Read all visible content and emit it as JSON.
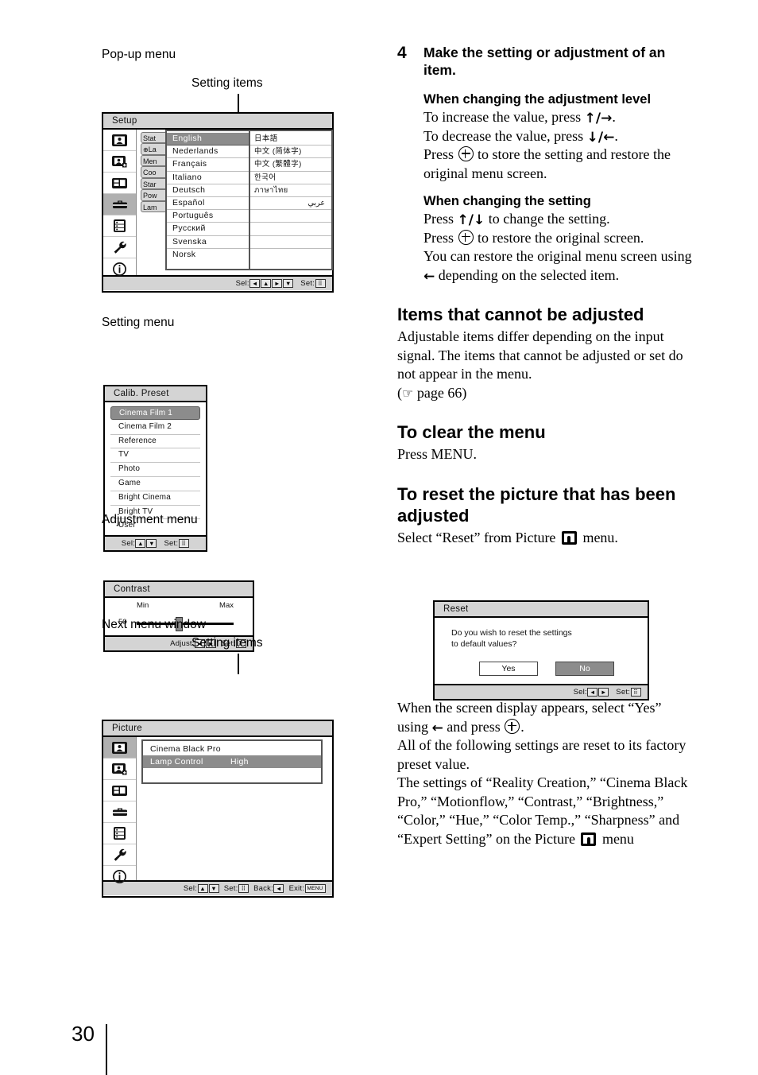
{
  "page": {
    "number": "30"
  },
  "left": {
    "captions": {
      "popup_menu": "Pop-up menu",
      "setting_items_1": "Setting items",
      "setting_menu": "Setting menu",
      "adjustment_menu": "Adjustment menu",
      "next_menu_window": "Next menu window",
      "setting_items_2": "Setting items"
    },
    "setup_window": {
      "title": "Setup",
      "side_icons": [
        "picture-icon",
        "picture-plus-icon",
        "screen-icon",
        "toolbox-icon",
        "list-icon",
        "wrench-icon",
        "info-icon"
      ],
      "selected_side_icon_index": 3,
      "hidden_labels": [
        "Stat",
        "La",
        "Men",
        "Coo",
        "Star",
        "Pow",
        "Lam"
      ],
      "languages_col1": [
        "English",
        "Nederlands",
        "Français",
        "Italiano",
        "Deutsch",
        "Español",
        "Português",
        "Русский",
        "Svenska",
        "Norsk"
      ],
      "selected_language": "English",
      "languages_col2": [
        "日本語",
        "中文 (简体字)",
        "中文 (繁體字)",
        "한국어",
        "ภาษาไทย",
        "عربي",
        "",
        "",
        "",
        ""
      ],
      "footer": {
        "sel_label": "Sel:",
        "set_label": "Set:",
        "sel_keys": [
          "◄",
          "▲",
          "►",
          "▼"
        ],
        "set_key": "⠿"
      }
    },
    "calib_window": {
      "title": "Calib. Preset",
      "items": [
        "Cinema Film 1",
        "Cinema Film 2",
        "Reference",
        "TV",
        "Photo",
        "Game",
        "Bright Cinema",
        "Bright TV",
        "User"
      ],
      "selected_item": "Cinema Film 1",
      "footer": {
        "sel_label": "Sel:",
        "set_label": "Set:",
        "sel_keys": [
          "▲",
          "▼"
        ],
        "set_key": "⠿"
      }
    },
    "contrast_window": {
      "title": "Contrast",
      "min_label": "Min",
      "max_label": "Max",
      "value": "50",
      "value_percent": 50,
      "footer": {
        "adjust_label": "Adjust:",
        "set_label": "Set:",
        "adjust_keys": [
          "◄",
          "►"
        ],
        "set_key": "⠿"
      }
    },
    "picture_window": {
      "title": "Picture",
      "side_icons": [
        "picture-icon",
        "picture-plus-icon",
        "screen-icon",
        "toolbox-icon",
        "list-icon",
        "wrench-icon",
        "info-icon"
      ],
      "selected_side_icon_index": 0,
      "items": [
        {
          "label": "Cinema Black Pro",
          "value": "",
          "selected": false
        },
        {
          "label": "Lamp Control",
          "value": "High",
          "selected": true
        }
      ],
      "footer": {
        "sel_label": "Sel:",
        "set_label": "Set:",
        "back_label": "Back:",
        "exit_label": "Exit:",
        "sel_keys": [
          "▲",
          "▼"
        ],
        "set_key": "⠿",
        "back_key": "◄",
        "exit_key": "MENU"
      }
    }
  },
  "right": {
    "step": {
      "number": "4",
      "text": "Make the setting or adjustment of an item."
    },
    "adjustment_level": {
      "heading": "When changing the adjustment level",
      "line1_pre": "To increase the value, press ",
      "line1_keys": "↑/→",
      "line1_post": ".",
      "line2_pre": "To decrease the value, press ",
      "line2_keys": "↓/←",
      "line2_post": ".",
      "line3_pre": "Press ",
      "line3_post": " to store the setting and restore the original menu screen."
    },
    "changing_setting": {
      "heading": "When changing the setting",
      "line1_pre": "Press ",
      "line1_keys": "↑/↓",
      "line1_post": " to change the setting.",
      "line2_pre": "Press ",
      "line2_post": " to restore the original screen.",
      "line3_pre": "You can restore the original menu screen using ",
      "line3_key": "←",
      "line3_post": " depending on the selected item."
    },
    "cannot_adjust": {
      "heading": "Items that cannot be adjusted",
      "body": "Adjustable items differ depending on the input signal. The items that cannot be adjusted or set do not appear in the menu.",
      "page_ref": "page 66"
    },
    "clear_menu": {
      "heading": "To clear the menu",
      "body": "Press MENU."
    },
    "reset_picture": {
      "heading": "To reset the picture that has been adjusted",
      "lead_pre": "Select “Reset” from Picture ",
      "lead_post": " menu."
    },
    "reset_window": {
      "title": "Reset",
      "question_line1": "Do you wish to reset the settings",
      "question_line2": "to default values?",
      "yes_label": "Yes",
      "no_label": "No",
      "selected_button": "No",
      "footer": {
        "sel_label": "Sel:",
        "set_label": "Set:",
        "sel_keys": [
          "◄",
          "►"
        ],
        "set_key": "⠿"
      }
    },
    "after_reset": {
      "p1_pre": "When the screen display appears, select “Yes” using ",
      "p1_key": "←",
      "p1_mid": " and press ",
      "p1_post": ".",
      "p2": "All of the following settings are reset to its factory preset value.",
      "p3_pre": "The settings of “Reality Creation,” “Cinema Black Pro,” “Motionflow,” “Contrast,” “Brightness,” “Color,” “Hue,” “Color Temp.,” “Sharpness” and “Expert Setting” on the Picture ",
      "p3_post": " menu"
    }
  }
}
